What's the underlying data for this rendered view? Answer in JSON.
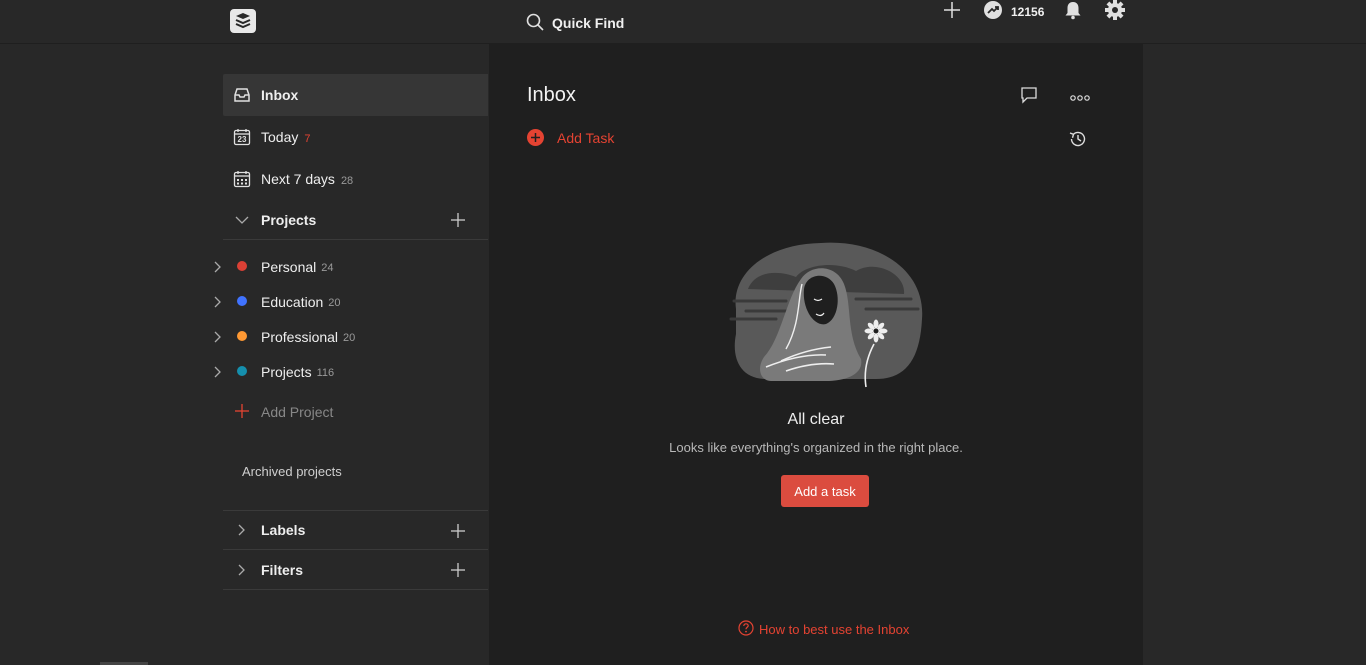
{
  "topbar": {
    "logo_icon": "todoist-logo-icon",
    "search_label": "Quick Find",
    "karma_count": "12156"
  },
  "sidebar": {
    "nav": [
      {
        "label": "Inbox",
        "icon": "inbox-icon",
        "count": ""
      },
      {
        "label": "Today",
        "icon": "calendar-today-icon",
        "count": "7",
        "calendar_day": "23"
      },
      {
        "label": "Next 7 days",
        "icon": "calendar-week-icon",
        "count": "28"
      }
    ],
    "projects_header": "Projects",
    "projects": [
      {
        "label": "Personal",
        "count": "24",
        "color": "#db4035"
      },
      {
        "label": "Education",
        "count": "20",
        "color": "#4073ff"
      },
      {
        "label": "Professional",
        "count": "20",
        "color": "#ff9933"
      },
      {
        "label": "Projects",
        "count": "116",
        "color": "#158fad"
      }
    ],
    "add_project_label": "Add Project",
    "archived_label": "Archived projects",
    "labels_header": "Labels",
    "filters_header": "Filters"
  },
  "main": {
    "title": "Inbox",
    "add_task_label": "Add Task",
    "empty_title": "All clear",
    "empty_subtitle": "Looks like everything's organized in the right place.",
    "add_task_button": "Add a task",
    "help_link": "How to best use the Inbox"
  },
  "colors": {
    "accent": "#e44332",
    "button": "#db4c3f"
  }
}
